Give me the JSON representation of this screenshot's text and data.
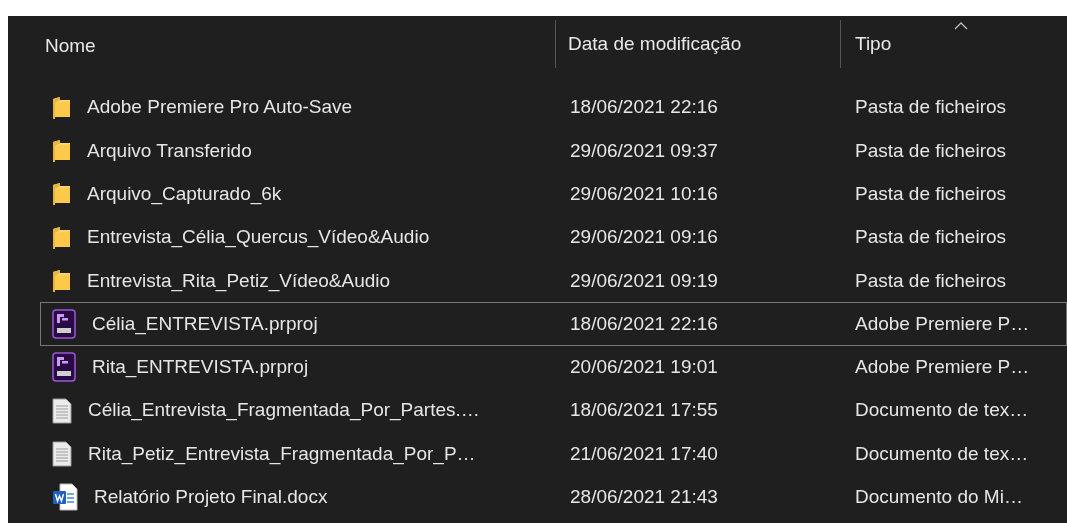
{
  "columns": [
    {
      "label": "Nome",
      "sorted": false
    },
    {
      "label": "Data de modificação",
      "sorted": false
    },
    {
      "label": "Tipo",
      "sorted": true
    }
  ],
  "rows": [
    {
      "kind": "folder",
      "name": "Adobe Premiere Pro Auto-Save",
      "date": "18/06/2021 22:16",
      "type": "Pasta de ficheiros",
      "focused": false
    },
    {
      "kind": "folder",
      "name": "Arquivo Transferido",
      "date": "29/06/2021 09:37",
      "type": "Pasta de ficheiros",
      "focused": false
    },
    {
      "kind": "folder",
      "name": "Arquivo_Capturado_6k",
      "date": "29/06/2021 10:16",
      "type": "Pasta de ficheiros",
      "focused": false
    },
    {
      "kind": "folder",
      "name": "Entrevista_Célia_Quercus_Vídeo&Audio",
      "date": "29/06/2021 09:16",
      "type": "Pasta de ficheiros",
      "focused": false
    },
    {
      "kind": "folder",
      "name": "Entrevista_Rita_Petiz_Vídeo&Audio",
      "date": "29/06/2021 09:19",
      "type": "Pasta de ficheiros",
      "focused": false
    },
    {
      "kind": "project",
      "name": "Célia_ENTREVISTA.prproj",
      "date": "18/06/2021 22:16",
      "type": "Adobe Premiere P…",
      "focused": true
    },
    {
      "kind": "project",
      "name": "Rita_ENTREVISTA.prproj",
      "date": "20/06/2021 19:01",
      "type": "Adobe Premiere P…",
      "focused": false
    },
    {
      "kind": "text",
      "name": "Célia_Entrevista_Fragmentada_Por_Partes.…",
      "date": "18/06/2021 17:55",
      "type": "Documento de tex…",
      "focused": false
    },
    {
      "kind": "text",
      "name": "Rita_Petiz_Entrevista_Fragmentada_Por_P…",
      "date": "21/06/2021 17:40",
      "type": "Documento de tex…",
      "focused": false
    },
    {
      "kind": "word",
      "name": "Relatório Projeto Final.docx",
      "date": "28/06/2021 21:43",
      "type": "Documento do Mi…",
      "focused": false
    }
  ]
}
